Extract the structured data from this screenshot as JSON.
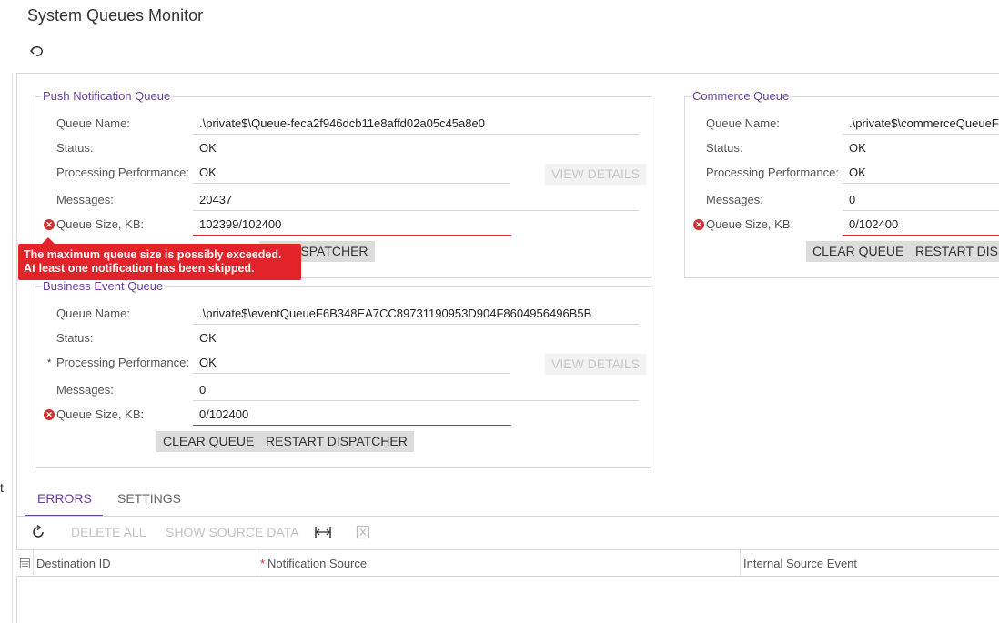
{
  "page": {
    "title": "System Queues Monitor"
  },
  "side_fragment": "t",
  "push_queue": {
    "legend": "Push Notification Queue",
    "queue_name_label": "Queue Name:",
    "queue_name": ".\\private$\\Queue-feca2f946dcb11e8affd02a05c45a8e0",
    "status_label": "Status:",
    "status": "OK",
    "perf_label": "Processing Performance:",
    "perf": "OK",
    "view_details": "VIEW DETAILS",
    "messages_label": "Messages:",
    "messages": "20437",
    "size_label": "Queue Size, KB:",
    "size": "102399/102400",
    "restart_label": "RESTART DISPATCHER",
    "restart_visible": "ART DISPATCHER"
  },
  "tooltip": {
    "line1": "The maximum queue size is possibly exceeded.",
    "line2": "At least one notification has been skipped."
  },
  "business_queue": {
    "legend": "Business Event Queue",
    "queue_name_label": "Queue Name:",
    "queue_name": ".\\private$\\eventQueueF6B348EA7CC89731190953D904F8604956496B5B",
    "status_label": "Status:",
    "status": "OK",
    "perf_star": "*",
    "perf_label": "Processing Performance:",
    "perf": "OK",
    "view_details": "VIEW DETAILS",
    "messages_label": "Messages:",
    "messages": "0",
    "size_label": "Queue Size, KB:",
    "size": "0/102400",
    "clear_label": "CLEAR QUEUE",
    "restart_label": "RESTART DISPATCHER"
  },
  "commerce_queue": {
    "legend": "Commerce Queue",
    "queue_name_label": "Queue Name:",
    "queue_name": ".\\private$\\commerceQueueF",
    "status_label": "Status:",
    "status": "OK",
    "perf_label": "Processing Performance:",
    "perf": "OK",
    "messages_label": "Messages:",
    "messages": "0",
    "size_label": "Queue Size, KB:",
    "size": "0/102400",
    "clear_label": "CLEAR QUEUE",
    "restart_label": "RESTART DISP"
  },
  "tabs": [
    {
      "label": "ERRORS",
      "active": true
    },
    {
      "label": "SETTINGS",
      "active": false
    }
  ],
  "toolbar": {
    "delete_all": "DELETE ALL",
    "show_source_data": "SHOW SOURCE DATA"
  },
  "grid": {
    "columns": [
      {
        "label": "Destination ID",
        "required": false
      },
      {
        "label": "Notification Source",
        "required": true
      },
      {
        "label": "Internal Source Event",
        "required": false
      }
    ],
    "required_mark": "*"
  },
  "colors": {
    "accent": "#6b3fa0",
    "error": "#d32f2f",
    "tooltip_bg": "#e2232a"
  }
}
